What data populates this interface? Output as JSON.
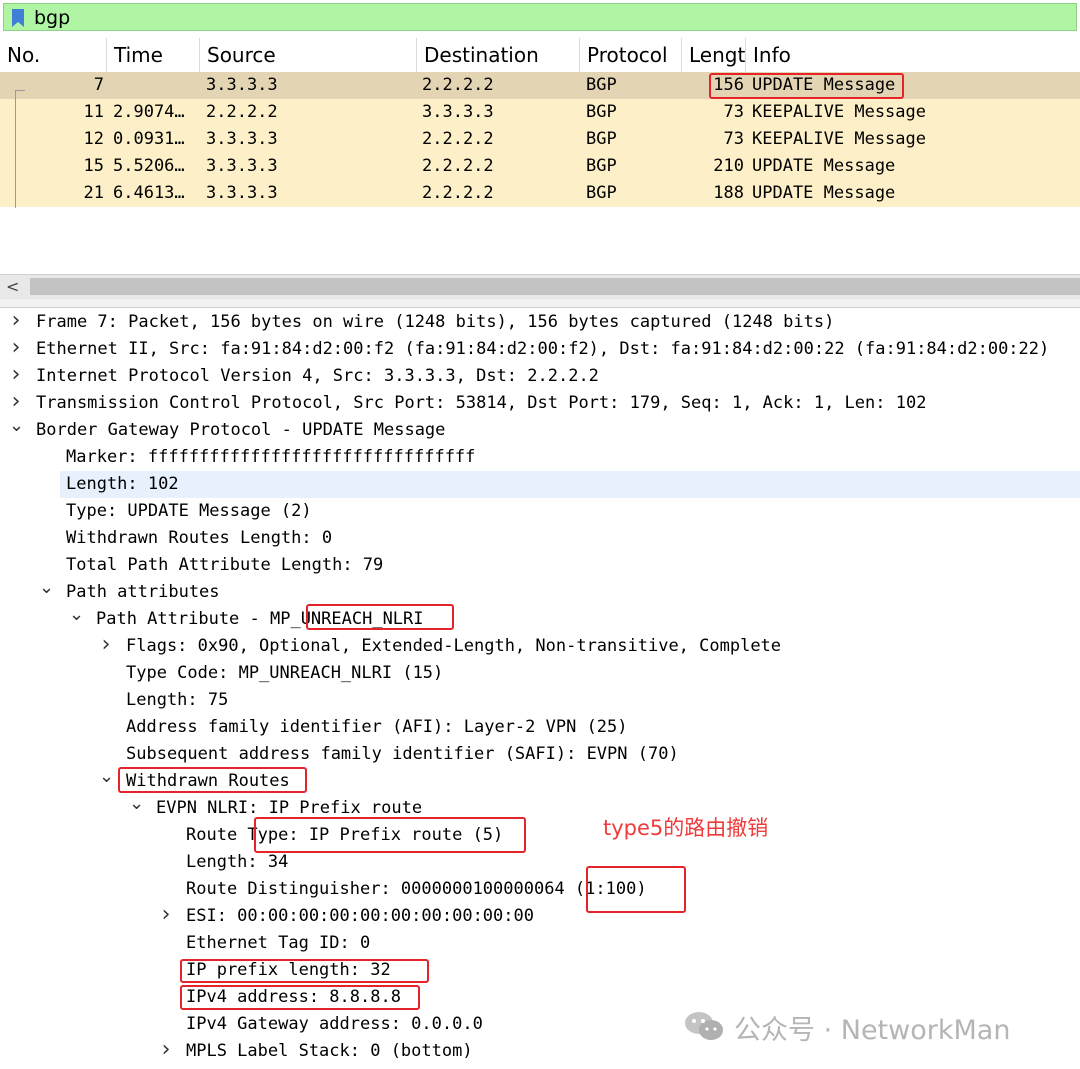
{
  "filter": {
    "value": "bgp",
    "icon": "bookmark-icon",
    "color": "#aff5a4"
  },
  "packet_list": {
    "columns": [
      "No.",
      "Time",
      "Source",
      "Destination",
      "Protocol",
      "Lengt",
      "Info"
    ],
    "rows": [
      {
        "no": "7",
        "time": "",
        "source": "3.3.3.3",
        "destination": "2.2.2.2",
        "protocol": "BGP",
        "length": "156",
        "info": "UPDATE Message",
        "selected": true
      },
      {
        "no": "11",
        "time": "2.9074…",
        "source": "2.2.2.2",
        "destination": "3.3.3.3",
        "protocol": "BGP",
        "length": "73",
        "info": "KEEPALIVE Message"
      },
      {
        "no": "12",
        "time": "0.0931…",
        "source": "3.3.3.3",
        "destination": "2.2.2.2",
        "protocol": "BGP",
        "length": "73",
        "info": "KEEPALIVE Message"
      },
      {
        "no": "15",
        "time": "5.5206…",
        "source": "3.3.3.3",
        "destination": "2.2.2.2",
        "protocol": "BGP",
        "length": "210",
        "info": "UPDATE Message"
      },
      {
        "no": "21",
        "time": "6.4613…",
        "source": "3.3.3.3",
        "destination": "2.2.2.2",
        "protocol": "BGP",
        "length": "188",
        "info": "UPDATE Message"
      }
    ],
    "row_color": "#fdf0c8",
    "selected_color": "#e3d5b4",
    "scroll_left_glyph": "<"
  },
  "detail": {
    "lines": [
      {
        "arrow": ">",
        "text": "Frame 7: Packet, 156 bytes on wire (1248 bits), 156 bytes captured (1248 bits)"
      },
      {
        "arrow": ">",
        "text": "Ethernet II, Src: fa:91:84:d2:00:f2 (fa:91:84:d2:00:f2), Dst: fa:91:84:d2:00:22 (fa:91:84:d2:00:22)"
      },
      {
        "arrow": ">",
        "text": "Internet Protocol Version 4, Src: 3.3.3.3, Dst: 2.2.2.2"
      },
      {
        "arrow": ">",
        "text": "Transmission Control Protocol, Src Port: 53814, Dst Port: 179, Seq: 1, Ack: 1, Len: 102"
      },
      {
        "arrow": "v",
        "text": "Border Gateway Protocol - UPDATE Message"
      },
      {
        "arrow": "",
        "text": "Marker: ffffffffffffffffffffffffffffffff"
      },
      {
        "arrow": "",
        "text": "Length: 102",
        "highlighted": true
      },
      {
        "arrow": "",
        "text": "Type: UPDATE Message (2)"
      },
      {
        "arrow": "",
        "text": "Withdrawn Routes Length: 0"
      },
      {
        "arrow": "",
        "text": "Total Path Attribute Length: 79"
      },
      {
        "arrow": "v",
        "text": "Path attributes"
      },
      {
        "arrow": "v",
        "text": "Path Attribute - MP_UNREACH_NLRI"
      },
      {
        "arrow": ">",
        "text": "Flags: 0x90, Optional, Extended-Length, Non-transitive, Complete"
      },
      {
        "arrow": "",
        "text": "Type Code: MP_UNREACH_NLRI (15)"
      },
      {
        "arrow": "",
        "text": "Length: 75"
      },
      {
        "arrow": "",
        "text": "Address family identifier (AFI): Layer-2 VPN (25)"
      },
      {
        "arrow": "",
        "text": "Subsequent address family identifier (SAFI): EVPN (70)"
      },
      {
        "arrow": "v",
        "text": "Withdrawn Routes"
      },
      {
        "arrow": "v",
        "text": "EVPN NLRI: IP Prefix route"
      },
      {
        "arrow": "",
        "text": "Route Type: IP Prefix route (5)"
      },
      {
        "arrow": "",
        "text": "Length: 34"
      },
      {
        "arrow": "",
        "text": "Route Distinguisher: 0000000100000064 (1:100)"
      },
      {
        "arrow": ">",
        "text": "ESI: 00:00:00:00:00:00:00:00:00:00"
      },
      {
        "arrow": "",
        "text": "Ethernet Tag ID: 0"
      },
      {
        "arrow": "",
        "text": "IP prefix length: 32"
      },
      {
        "arrow": "",
        "text": "IPv4 address: 8.8.8.8"
      },
      {
        "arrow": "",
        "text": "IPv4 Gateway address: 0.0.0.0"
      },
      {
        "arrow": ">",
        "text": "MPLS Label Stack: 0 (bottom)"
      }
    ],
    "highlight_color": "#e7f1fd"
  },
  "annotation": {
    "text": "type5的路由撤销",
    "color": "#ef3b3b",
    "box_color": "#e5242a"
  },
  "watermark": {
    "text": "公众号 · NetworkMan",
    "icon": "wechat-icon"
  }
}
